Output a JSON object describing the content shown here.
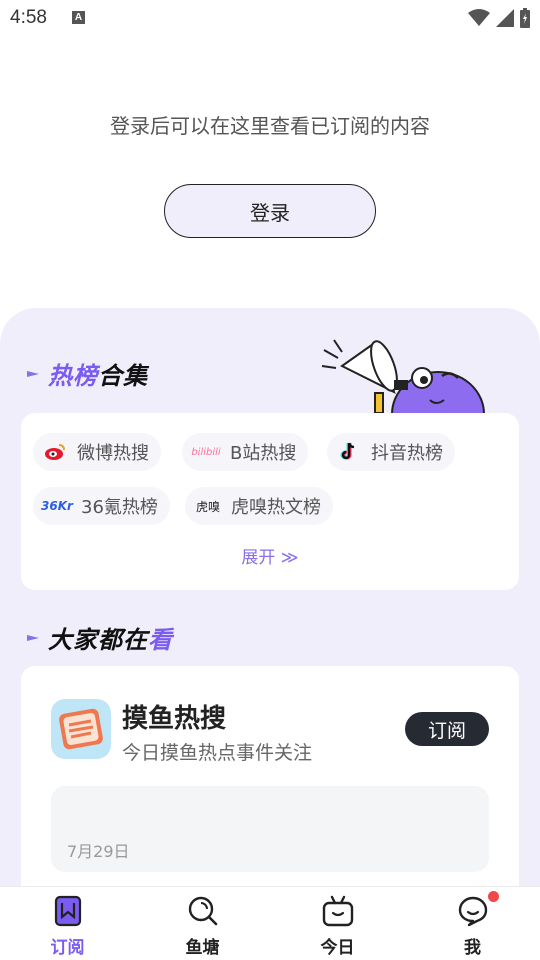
{
  "status_bar": {
    "time": "4:58",
    "notification_badge": "A"
  },
  "login": {
    "message": "登录后可以在这里查看已订阅的内容",
    "button_label": "登录"
  },
  "hot_section": {
    "title_highlight": "热榜",
    "title_rest": "合集",
    "chips": [
      {
        "label": "微博热搜",
        "icon": "weibo-icon",
        "icon_text": ""
      },
      {
        "label": "B站热搜",
        "icon": "bilibili-icon",
        "icon_text": "bilibili"
      },
      {
        "label": "抖音热榜",
        "icon": "douyin-icon",
        "icon_text": ""
      },
      {
        "label": "36氪热榜",
        "icon": "36kr-icon",
        "icon_text": "36Kr"
      },
      {
        "label": "虎嗅热文榜",
        "icon": "huxiu-icon",
        "icon_text": "虎嗅"
      }
    ],
    "expand_label": "展开 ≫"
  },
  "popular_section": {
    "title_rest": "大家都在",
    "title_highlight": "看",
    "card": {
      "name": "摸鱼热搜",
      "description": "今日摸鱼热点事件关注",
      "subscribe_label": "订阅",
      "date": "7月29日"
    }
  },
  "bottom_nav": [
    {
      "label": "订阅",
      "icon": "bookmark-icon",
      "active": true
    },
    {
      "label": "鱼塘",
      "icon": "search-icon",
      "active": false
    },
    {
      "label": "今日",
      "icon": "tv-icon",
      "active": false
    },
    {
      "label": "我",
      "icon": "chat-face-icon",
      "active": false
    }
  ],
  "colors": {
    "accent": "#7a5cf0",
    "panel_bg": "#f1eefc",
    "badge": "#f04848",
    "dark_button": "#262a33"
  }
}
